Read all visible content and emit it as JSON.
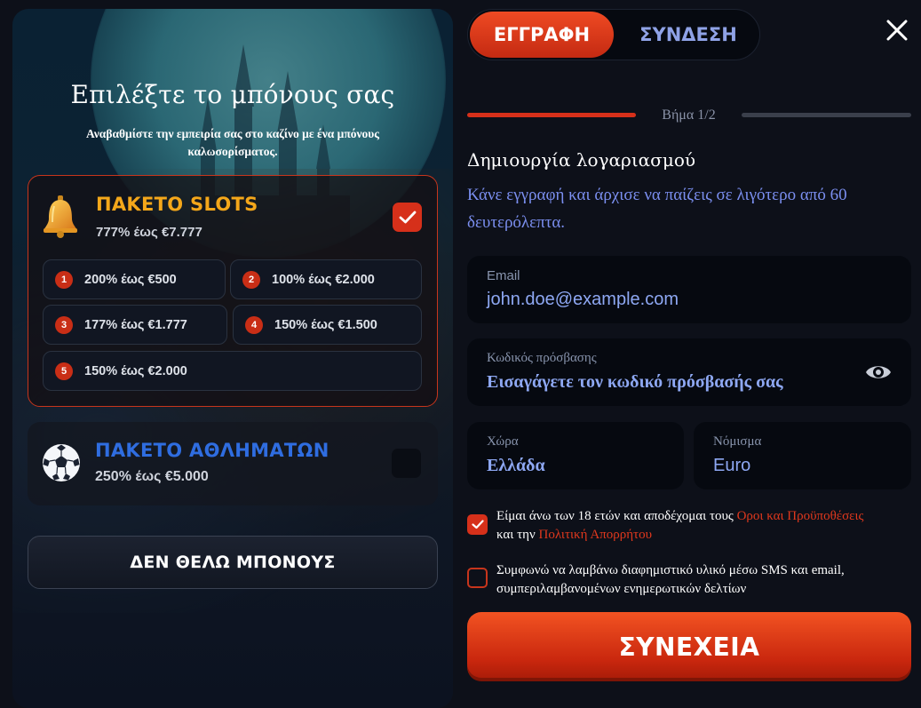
{
  "bonus": {
    "title": "Επιλέξτε το μπόνους σας",
    "subtitle": "Αναβαθμίστε την εμπειρία σας στο καζίνο με ένα μπόνους καλωσορίσματος.",
    "slots": {
      "title": "ΠΑΚΕΤΟ SLOTS",
      "subtitle": "777% έως €7.777",
      "icon": "bell-icon",
      "selected": true,
      "tiers": [
        {
          "num": "1",
          "label": "200% έως €500"
        },
        {
          "num": "2",
          "label": "100% έως €2.000"
        },
        {
          "num": "3",
          "label": "177% έως €1.777"
        },
        {
          "num": "4",
          "label": "150% έως €1.500"
        },
        {
          "num": "5",
          "label": "150% έως €2.000"
        }
      ]
    },
    "sports": {
      "title": "ΠΑΚΕΤΟ ΑΘΛΗΜΑΤΩΝ",
      "subtitle": "250% έως €5.000",
      "icon": "soccer-ball-icon",
      "selected": false
    },
    "no_bonus_label": "ΔΕΝ ΘΕΛΩ ΜΠΟΝΟΥΣ"
  },
  "tabs": {
    "register": "ΕΓΓΡΑΦΗ",
    "login": "ΣΥΝΔΕΣΗ",
    "active": "register"
  },
  "step": {
    "label": "Βήμα 1/2",
    "current": 1,
    "total": 2
  },
  "form": {
    "heading": "Δημιουργία λογαριασμού",
    "description": "Κάνε εγγραφή και άρχισε να παίζεις σε λιγότερο από 60 δευτερόλεπτα.",
    "email": {
      "label": "Email",
      "value": "john.doe@example.com"
    },
    "password": {
      "label": "Κωδικός πρόσβασης",
      "placeholder": "Εισαγάγετε τον κωδικό πρόσβασής σας"
    },
    "country": {
      "label": "Χώρα",
      "value": "Ελλάδα"
    },
    "currency": {
      "label": "Νόμισμα",
      "value": "Euro"
    },
    "terms": {
      "checked": true,
      "text_before": "Είμαι άνω των 18 ετών και αποδέχομαι τους ",
      "terms_link": "Οροι και Προϋποθέσεις",
      "text_middle": " και την ",
      "privacy_link": "Πολιτική Απορρήτου"
    },
    "marketing": {
      "checked": false,
      "text": "Συμφωνώ να λαμβάνω διαφημιστικό υλικό μέσω SMS και email, συμπεριλαμβανομένων ενημερωτικών δελτίων"
    },
    "continue_label": "ΣΥΝΕΧΕΙΑ"
  },
  "colors": {
    "accent": "#d6301a",
    "slots_title": "#f4a71a",
    "sports_title": "#2f6de0",
    "link": "#e0381d",
    "input_text": "#8ea8f3"
  }
}
